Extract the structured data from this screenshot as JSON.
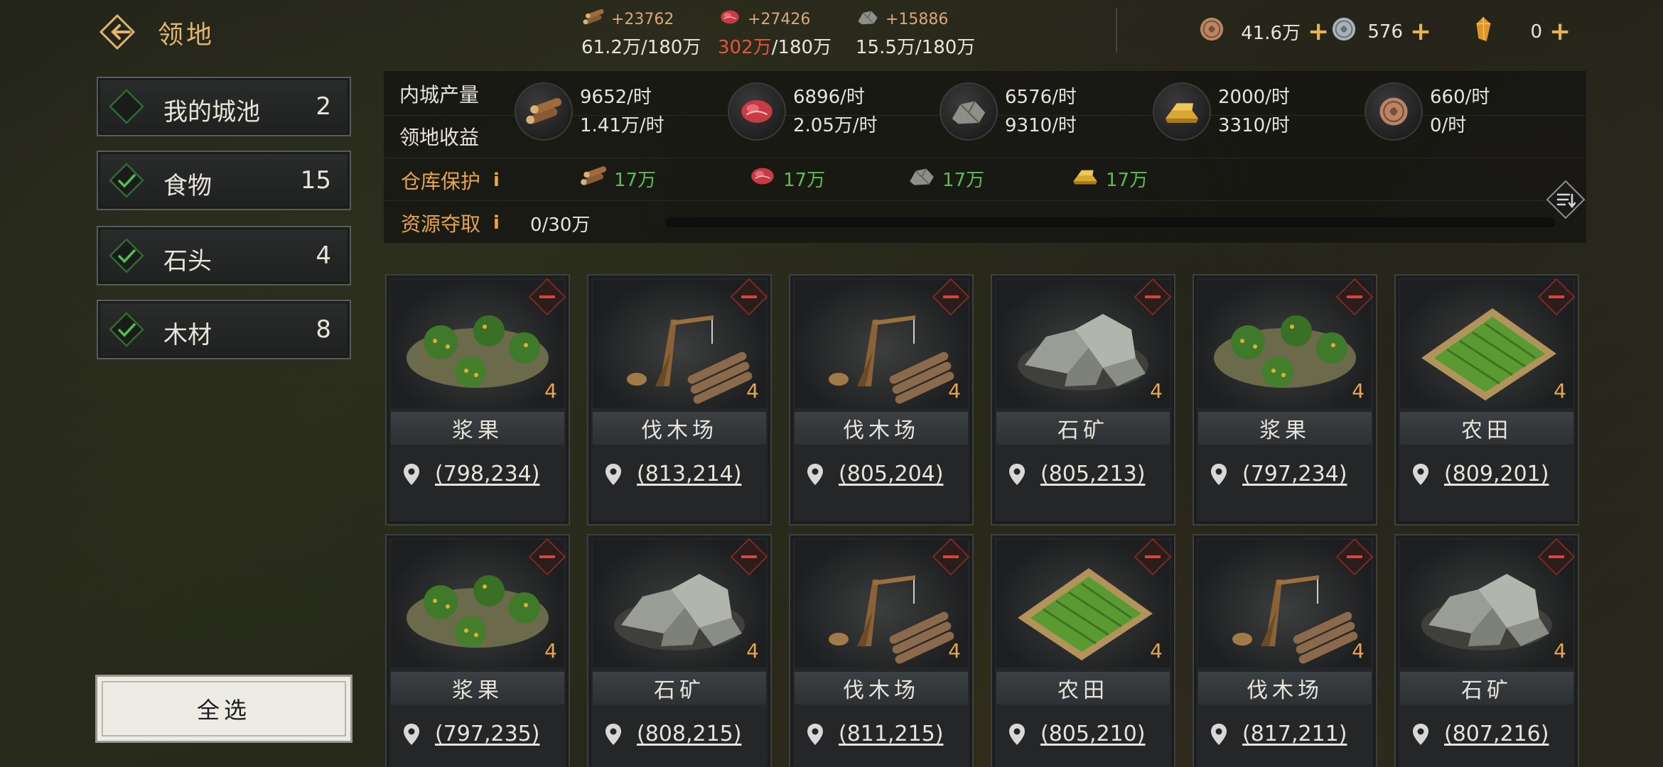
{
  "header": {
    "title": "领地",
    "resources": [
      {
        "icon": "wood-icon",
        "delta": "+23762",
        "current": "61.2万",
        "capacity": "/180万",
        "over": false
      },
      {
        "icon": "meat-icon",
        "delta": "+27426",
        "current": "302万",
        "capacity": "/180万",
        "over": true
      },
      {
        "icon": "stone-icon",
        "delta": "+15886",
        "current": "15.5万",
        "capacity": "/180万",
        "over": false
      }
    ],
    "currencies": [
      {
        "icon": "copper-coin-icon",
        "value": "41.6万"
      },
      {
        "icon": "silver-coin-icon",
        "value": "576"
      },
      {
        "icon": "gold-crystal-icon",
        "value": "0"
      }
    ],
    "plus": "+"
  },
  "filters": [
    {
      "label": "我的城池",
      "count": "2",
      "checked": false
    },
    {
      "label": "食物",
      "count": "15",
      "checked": true
    },
    {
      "label": "石头",
      "count": "4",
      "checked": true
    },
    {
      "label": "木材",
      "count": "8",
      "checked": true
    }
  ],
  "select_all": "全选",
  "panel": {
    "inner_output_label": "内城产量",
    "territory_income_label": "领地收益",
    "production": [
      {
        "icon": "wood-icon",
        "inner": "9652/时",
        "territory": "1.41万/时"
      },
      {
        "icon": "meat-icon",
        "inner": "6896/时",
        "territory": "2.05万/时"
      },
      {
        "icon": "stone-icon",
        "inner": "6576/时",
        "territory": "9310/时"
      },
      {
        "icon": "gold-bar-icon",
        "inner": "2000/时",
        "territory": "3310/时"
      },
      {
        "icon": "copper-coin-icon",
        "inner": "660/时",
        "territory": "0/时"
      }
    ],
    "protection_label": "仓库保护",
    "protection": [
      {
        "icon": "wood-icon",
        "value": "17万"
      },
      {
        "icon": "meat-icon",
        "value": "17万"
      },
      {
        "icon": "stone-icon",
        "value": "17万"
      },
      {
        "icon": "gold-bar-icon",
        "value": "17万"
      }
    ],
    "plunder_label": "资源夺取",
    "plunder_value": "0/30万",
    "plunder_progress": 0,
    "info_glyph": "i"
  },
  "cards": [
    {
      "type": "berry",
      "name": "浆果",
      "level": "4",
      "coords": "(798,234)"
    },
    {
      "type": "lumber",
      "name": "伐木场",
      "level": "4",
      "coords": "(813,214)"
    },
    {
      "type": "lumber",
      "name": "伐木场",
      "level": "4",
      "coords": "(805,204)"
    },
    {
      "type": "stone",
      "name": "石矿",
      "level": "4",
      "coords": "(805,213)"
    },
    {
      "type": "berry",
      "name": "浆果",
      "level": "4",
      "coords": "(797,234)"
    },
    {
      "type": "farm",
      "name": "农田",
      "level": "4",
      "coords": "(809,201)"
    },
    {
      "type": "berry",
      "name": "浆果",
      "level": "4",
      "coords": "(797,235)"
    },
    {
      "type": "stone",
      "name": "石矿",
      "level": "4",
      "coords": "(808,215)"
    },
    {
      "type": "lumber",
      "name": "伐木场",
      "level": "4",
      "coords": "(811,215)"
    },
    {
      "type": "farm",
      "name": "农田",
      "level": "4",
      "coords": "(805,210)"
    },
    {
      "type": "lumber",
      "name": "伐木场",
      "level": "4",
      "coords": "(817,211)"
    },
    {
      "type": "stone",
      "name": "石矿",
      "level": "4",
      "coords": "(807,216)"
    }
  ],
  "colors": {
    "accent": "#e2b56a",
    "warning": "#e2563a",
    "positive": "#58c04a",
    "remove": "#c23a30"
  }
}
